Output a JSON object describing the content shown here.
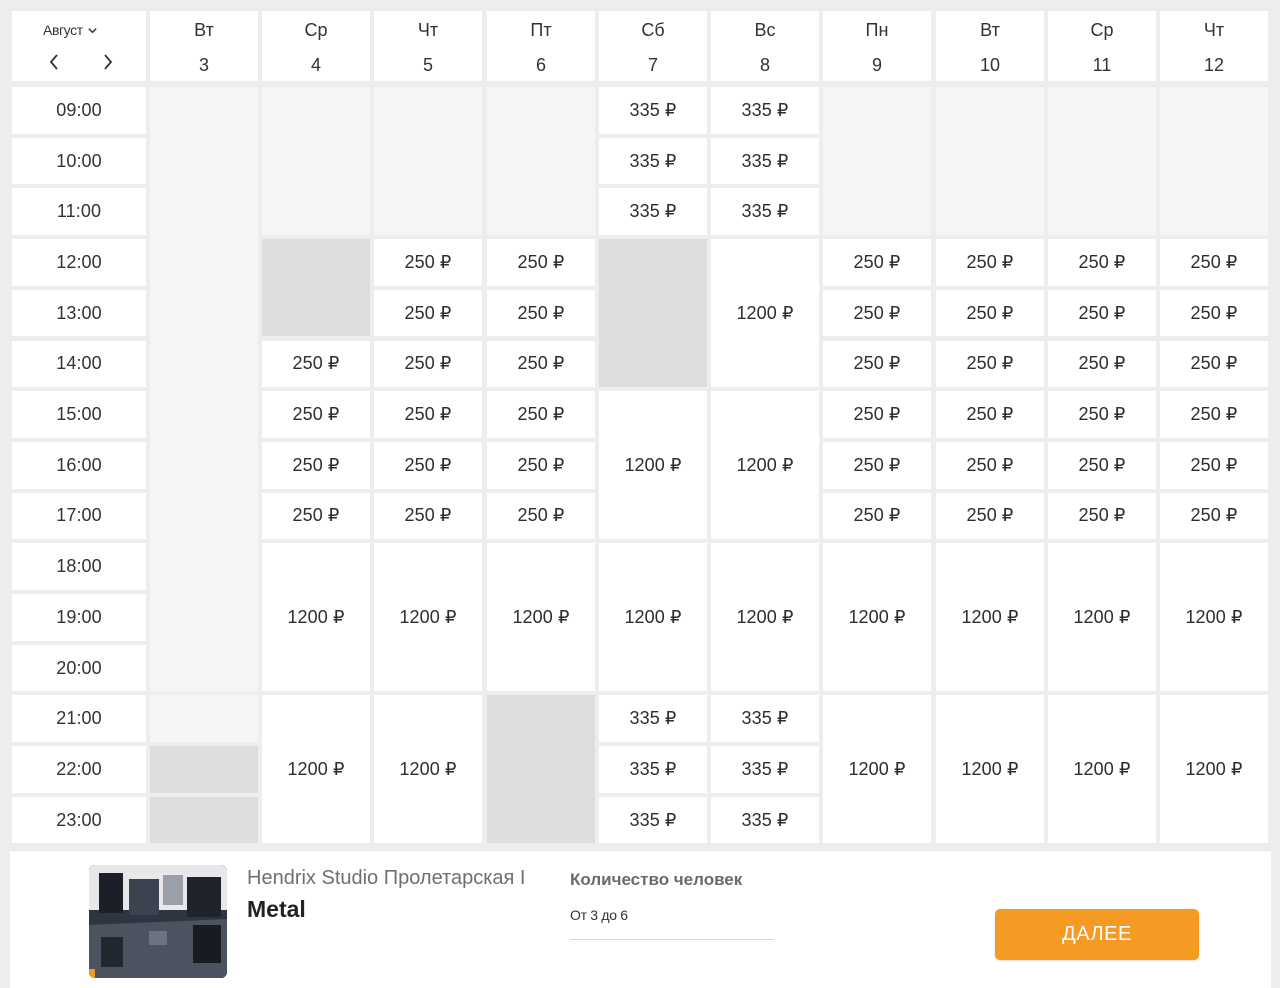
{
  "calendar": {
    "month": "Август",
    "days": [
      {
        "dow": "Вт",
        "num": "3"
      },
      {
        "dow": "Ср",
        "num": "4"
      },
      {
        "dow": "Чт",
        "num": "5"
      },
      {
        "dow": "Пт",
        "num": "6"
      },
      {
        "dow": "Сб",
        "num": "7"
      },
      {
        "dow": "Вс",
        "num": "8"
      },
      {
        "dow": "Пн",
        "num": "9"
      },
      {
        "dow": "Вт",
        "num": "10"
      },
      {
        "dow": "Ср",
        "num": "11"
      },
      {
        "dow": "Чт",
        "num": "12"
      }
    ],
    "times": [
      "09:00",
      "10:00",
      "11:00",
      "12:00",
      "13:00",
      "14:00",
      "15:00",
      "16:00",
      "17:00",
      "18:00",
      "19:00",
      "20:00",
      "21:00",
      "22:00",
      "23:00"
    ],
    "columns": [
      [
        {
          "span": 12,
          "status": "closed"
        },
        {
          "span": 1,
          "status": "closed"
        },
        {
          "span": 1,
          "status": "booked"
        },
        {
          "span": 1,
          "status": "booked"
        }
      ],
      [
        {
          "span": 3,
          "status": "closed"
        },
        {
          "span": 2,
          "status": "booked"
        },
        {
          "span": 1,
          "status": "free",
          "price": "250 ₽"
        },
        {
          "span": 1,
          "status": "free",
          "price": "250 ₽"
        },
        {
          "span": 1,
          "status": "free",
          "price": "250 ₽"
        },
        {
          "span": 1,
          "status": "free",
          "price": "250 ₽"
        },
        {
          "span": 3,
          "status": "free",
          "price": "1200 ₽"
        },
        {
          "span": 3,
          "status": "free",
          "price": "1200 ₽"
        }
      ],
      [
        {
          "span": 3,
          "status": "closed"
        },
        {
          "span": 1,
          "status": "free",
          "price": "250 ₽"
        },
        {
          "span": 1,
          "status": "free",
          "price": "250 ₽"
        },
        {
          "span": 1,
          "status": "free",
          "price": "250 ₽"
        },
        {
          "span": 1,
          "status": "free",
          "price": "250 ₽"
        },
        {
          "span": 1,
          "status": "free",
          "price": "250 ₽"
        },
        {
          "span": 1,
          "status": "free",
          "price": "250 ₽"
        },
        {
          "span": 3,
          "status": "free",
          "price": "1200 ₽"
        },
        {
          "span": 3,
          "status": "free",
          "price": "1200 ₽"
        }
      ],
      [
        {
          "span": 3,
          "status": "closed"
        },
        {
          "span": 1,
          "status": "free",
          "price": "250 ₽"
        },
        {
          "span": 1,
          "status": "free",
          "price": "250 ₽"
        },
        {
          "span": 1,
          "status": "free",
          "price": "250 ₽"
        },
        {
          "span": 1,
          "status": "free",
          "price": "250 ₽"
        },
        {
          "span": 1,
          "status": "free",
          "price": "250 ₽"
        },
        {
          "span": 1,
          "status": "free",
          "price": "250 ₽"
        },
        {
          "span": 3,
          "status": "free",
          "price": "1200 ₽"
        },
        {
          "span": 3,
          "status": "booked"
        }
      ],
      [
        {
          "span": 1,
          "status": "free",
          "price": "335 ₽"
        },
        {
          "span": 1,
          "status": "free",
          "price": "335 ₽"
        },
        {
          "span": 1,
          "status": "free",
          "price": "335 ₽"
        },
        {
          "span": 3,
          "status": "booked"
        },
        {
          "span": 3,
          "status": "free",
          "price": "1200 ₽"
        },
        {
          "span": 3,
          "status": "free",
          "price": "1200 ₽"
        },
        {
          "span": 1,
          "status": "free",
          "price": "335 ₽"
        },
        {
          "span": 1,
          "status": "free",
          "price": "335 ₽"
        },
        {
          "span": 1,
          "status": "free",
          "price": "335 ₽"
        }
      ],
      [
        {
          "span": 1,
          "status": "free",
          "price": "335 ₽"
        },
        {
          "span": 1,
          "status": "free",
          "price": "335 ₽"
        },
        {
          "span": 1,
          "status": "free",
          "price": "335 ₽"
        },
        {
          "span": 3,
          "status": "free",
          "price": "1200 ₽"
        },
        {
          "span": 3,
          "status": "free",
          "price": "1200 ₽"
        },
        {
          "span": 3,
          "status": "free",
          "price": "1200 ₽"
        },
        {
          "span": 1,
          "status": "free",
          "price": "335 ₽"
        },
        {
          "span": 1,
          "status": "free",
          "price": "335 ₽"
        },
        {
          "span": 1,
          "status": "free",
          "price": "335 ₽"
        }
      ],
      [
        {
          "span": 3,
          "status": "closed"
        },
        {
          "span": 1,
          "status": "free",
          "price": "250 ₽"
        },
        {
          "span": 1,
          "status": "free",
          "price": "250 ₽"
        },
        {
          "span": 1,
          "status": "free",
          "price": "250 ₽"
        },
        {
          "span": 1,
          "status": "free",
          "price": "250 ₽"
        },
        {
          "span": 1,
          "status": "free",
          "price": "250 ₽"
        },
        {
          "span": 1,
          "status": "free",
          "price": "250 ₽"
        },
        {
          "span": 3,
          "status": "free",
          "price": "1200 ₽"
        },
        {
          "span": 3,
          "status": "free",
          "price": "1200 ₽"
        }
      ],
      [
        {
          "span": 3,
          "status": "closed"
        },
        {
          "span": 1,
          "status": "free",
          "price": "250 ₽"
        },
        {
          "span": 1,
          "status": "free",
          "price": "250 ₽"
        },
        {
          "span": 1,
          "status": "free",
          "price": "250 ₽"
        },
        {
          "span": 1,
          "status": "free",
          "price": "250 ₽"
        },
        {
          "span": 1,
          "status": "free",
          "price": "250 ₽"
        },
        {
          "span": 1,
          "status": "free",
          "price": "250 ₽"
        },
        {
          "span": 3,
          "status": "free",
          "price": "1200 ₽"
        },
        {
          "span": 3,
          "status": "free",
          "price": "1200 ₽"
        }
      ],
      [
        {
          "span": 3,
          "status": "closed"
        },
        {
          "span": 1,
          "status": "free",
          "price": "250 ₽"
        },
        {
          "span": 1,
          "status": "free",
          "price": "250 ₽"
        },
        {
          "span": 1,
          "status": "free",
          "price": "250 ₽"
        },
        {
          "span": 1,
          "status": "free",
          "price": "250 ₽"
        },
        {
          "span": 1,
          "status": "free",
          "price": "250 ₽"
        },
        {
          "span": 1,
          "status": "free",
          "price": "250 ₽"
        },
        {
          "span": 3,
          "status": "free",
          "price": "1200 ₽"
        },
        {
          "span": 3,
          "status": "free",
          "price": "1200 ₽"
        }
      ],
      [
        {
          "span": 3,
          "status": "closed"
        },
        {
          "span": 1,
          "status": "free",
          "price": "250 ₽"
        },
        {
          "span": 1,
          "status": "free",
          "price": "250 ₽"
        },
        {
          "span": 1,
          "status": "free",
          "price": "250 ₽"
        },
        {
          "span": 1,
          "status": "free",
          "price": "250 ₽"
        },
        {
          "span": 1,
          "status": "free",
          "price": "250 ₽"
        },
        {
          "span": 1,
          "status": "free",
          "price": "250 ₽"
        },
        {
          "span": 3,
          "status": "free",
          "price": "1200 ₽"
        },
        {
          "span": 3,
          "status": "free",
          "price": "1200 ₽"
        }
      ]
    ]
  },
  "footer": {
    "studio": "Hendrix Studio Пролетарская I",
    "room": "Metal",
    "people_label": "Количество человек",
    "people_value": "От 3 до 6",
    "next_label": "ДАЛЕЕ"
  },
  "colors": {
    "accent": "#f59a23",
    "closed": "#f5f5f5",
    "booked": "#dddde0",
    "free": "#ffffff"
  }
}
